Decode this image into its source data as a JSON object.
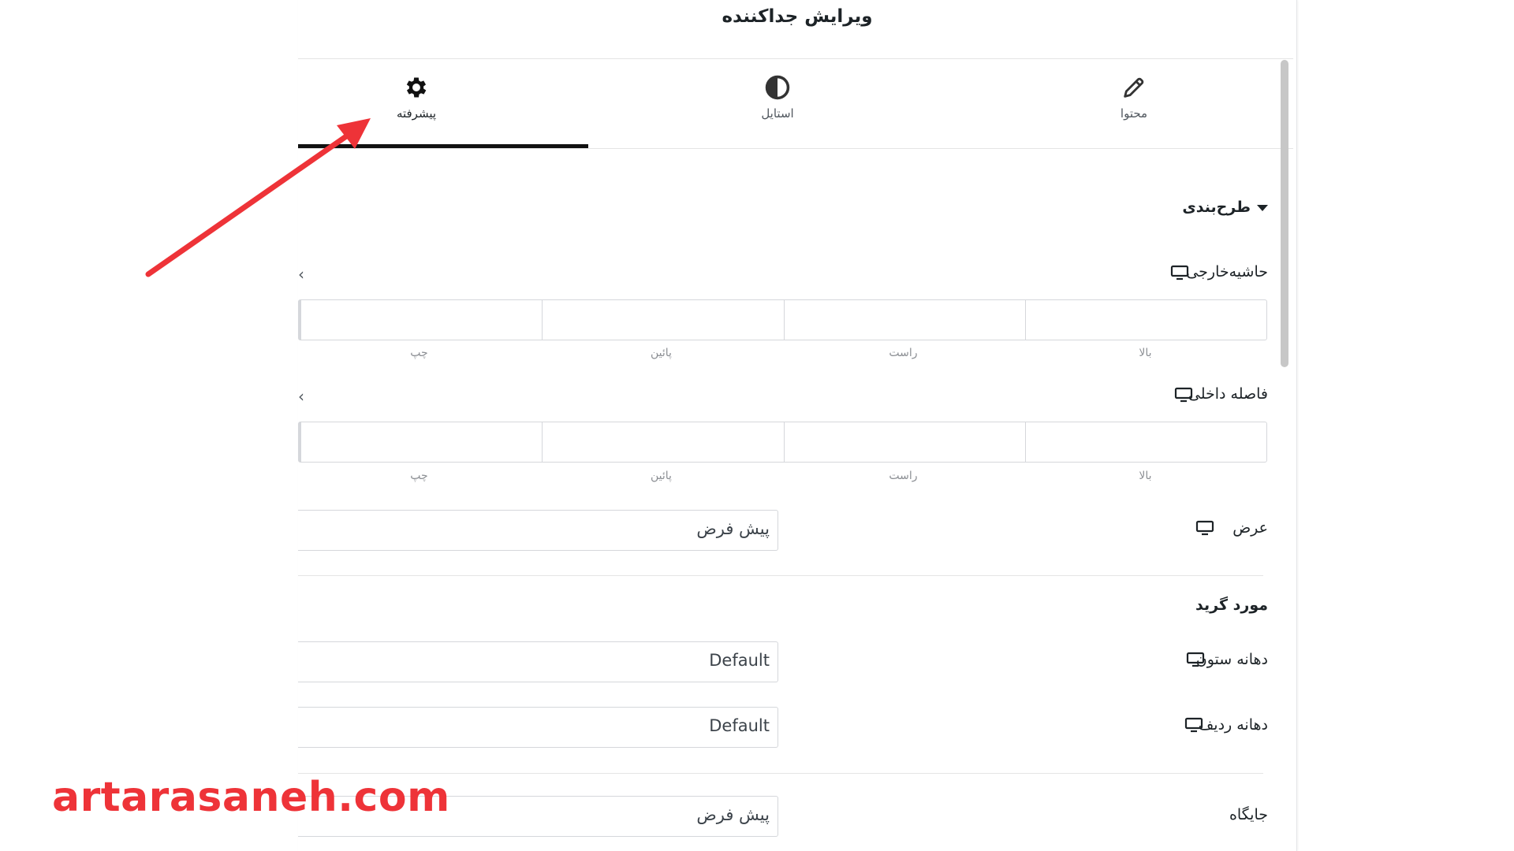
{
  "panel": {
    "title": "ویرایش جداکننده"
  },
  "tabs": [
    {
      "label": "پیشرفته",
      "icon": "gear-icon",
      "active": true
    },
    {
      "label": "استایل",
      "icon": "half-circle-icon",
      "active": false
    },
    {
      "label": "محتوا",
      "icon": "pencil-icon",
      "active": false
    }
  ],
  "layout_section": {
    "title": "طرح‌بندی",
    "margin": {
      "label": "حاشیه‌خارجی",
      "sides": [
        "بالا",
        "راست",
        "پائین",
        "چپ"
      ]
    },
    "padding": {
      "label": "فاصله داخلی",
      "sides": [
        "بالا",
        "راست",
        "پائین",
        "چپ"
      ]
    },
    "width": {
      "label": "عرض",
      "value": "پیش فرض"
    }
  },
  "grid_section": {
    "title": "مورد گرید",
    "column_gap": {
      "label": "دهانه ستون",
      "value": "Default"
    },
    "row_gap": {
      "label": "دهانه ردیف",
      "value": "Default"
    }
  },
  "position": {
    "label": "جایگاه",
    "value": "پیش فرض"
  },
  "watermark": "artarasaneh.com",
  "colors": {
    "accent_red": "#ee3338",
    "tab_underline": "#111111"
  }
}
